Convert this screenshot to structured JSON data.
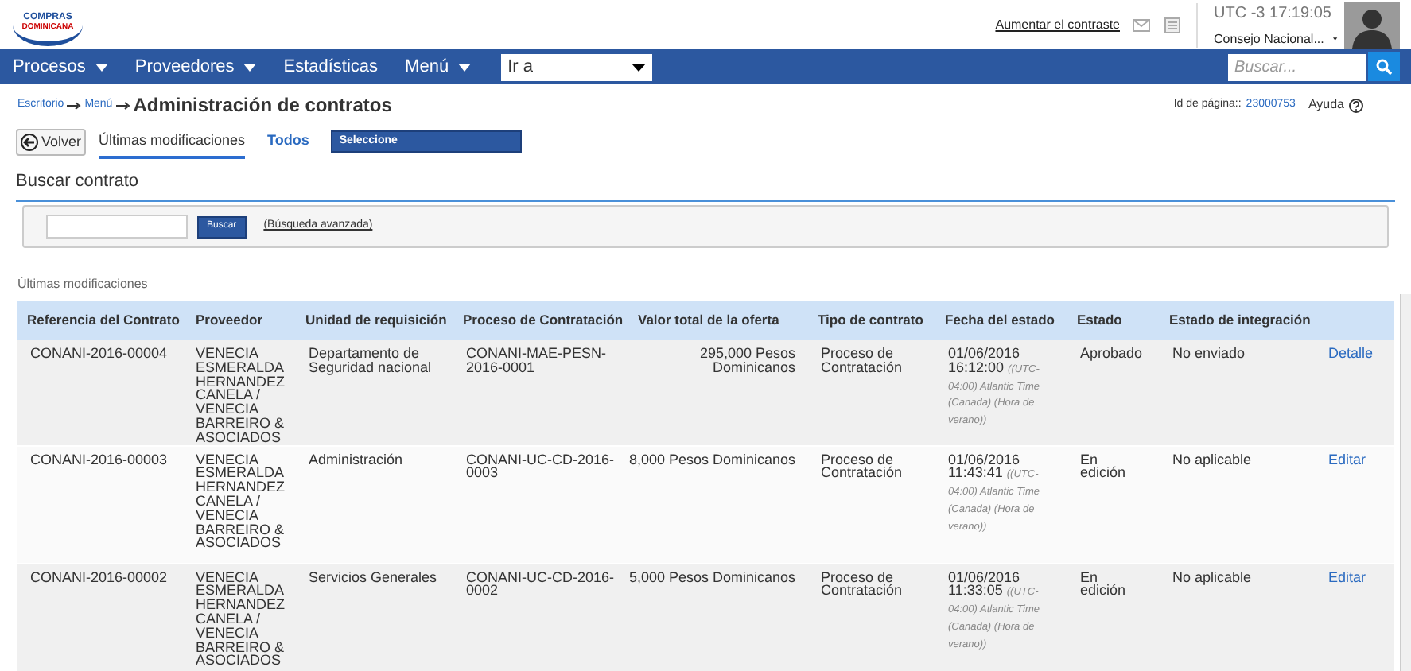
{
  "header": {
    "logo_text": [
      "COMPRAS",
      "DOMINICANA"
    ],
    "contrast_link": "Aumentar el contraste",
    "clock": "UTC -3",
    "time": "17:19:05",
    "user": "Consejo Nacional..."
  },
  "nav": {
    "items": [
      {
        "label": "Procesos",
        "dropdown": true
      },
      {
        "label": "Proveedores",
        "dropdown": true
      },
      {
        "label": "Estadísticas",
        "dropdown": false
      },
      {
        "label": "Menú",
        "dropdown": true
      }
    ],
    "goto_select": "Ir a",
    "search": {
      "placeholder": "Buscar..."
    }
  },
  "breadcrumb": [
    "Escritorio",
    "Menú"
  ],
  "page_title": "Administración de contratos",
  "page_id_label": "Id de página::",
  "page_id": "23000753",
  "help": "Ayuda",
  "back_button": "Volver",
  "tabs": [
    {
      "label": "Últimas modificaciones",
      "selected": true
    },
    {
      "label": "Todos",
      "selected": false
    }
  ],
  "filter_select": "Seleccione",
  "search_section": {
    "title": "Buscar contrato",
    "button": "Buscar",
    "advanced_link": "(Búsqueda avanzada)"
  },
  "list_title": "Últimas modificaciones",
  "table": {
    "columns": [
      "Referencia del Contrato",
      "Proveedor",
      "Unidad de requisición",
      "Proceso de Contratación",
      "Valor total de la oferta",
      "Tipo de contrato",
      "Fecha del estado",
      "Estado",
      "Estado de integración"
    ],
    "rows": [
      {
        "reference": "CONANI-2016-00004",
        "supplier": "VENECIA ESMERALDA HERNANDEZ CANELA / VENECIA BARREIRO & ASOCIADOS",
        "unit": "Departamento de Seguridad nacional",
        "process": "CONANI-MAE-PESN-2016-0001",
        "value": "295,000 Pesos Dominicanos",
        "type": "Proceso de Contratación",
        "date": "01/06/2016 16:12:00",
        "timezone": "((UTC-04:00) Atlantic Time (Canada) (Hora de verano))",
        "status": "Aprobado",
        "integration": "No enviado",
        "action": "Detalle"
      },
      {
        "reference": "CONANI-2016-00003",
        "supplier": "VENECIA ESMERALDA HERNANDEZ CANELA / VENECIA BARREIRO & ASOCIADOS",
        "unit": "Administración",
        "process": "CONANI-UC-CD-2016-0003",
        "value": "8,000 Pesos Dominicanos",
        "type": "Proceso de Contratación",
        "date": "01/06/2016 11:43:41",
        "timezone": "((UTC-04:00) Atlantic Time (Canada) (Hora de verano))",
        "status": "En edición",
        "integration": "No aplicable",
        "action": "Editar"
      },
      {
        "reference": "CONANI-2016-00002",
        "supplier": "VENECIA ESMERALDA HERNANDEZ CANELA / VENECIA BARREIRO & ASOCIADOS",
        "unit": "Servicios Generales",
        "process": "CONANI-UC-CD-2016-0002",
        "value": "5,000 Pesos Dominicanos",
        "type": "Proceso de Contratación",
        "date": "01/06/2016 11:33:05",
        "timezone": "((UTC-04:00) Atlantic Time (Canada) (Hora de verano))",
        "status": "En edición",
        "integration": "No aplicable",
        "action": "Editar"
      }
    ]
  }
}
